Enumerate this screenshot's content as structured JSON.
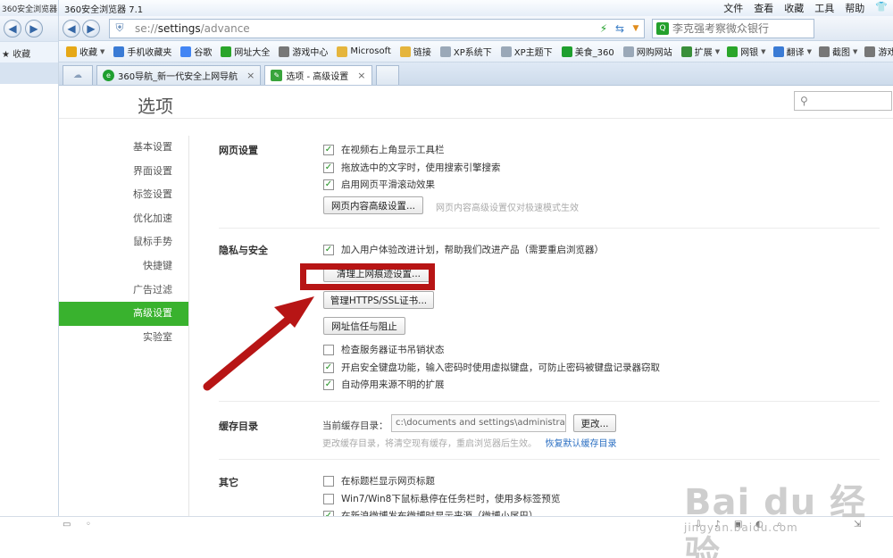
{
  "ghost": {
    "title": "360安全浏览器",
    "fav": "收藏"
  },
  "window": {
    "title": "360安全浏览器 7.1",
    "menus": [
      "文件",
      "查看",
      "收藏",
      "工具",
      "帮助"
    ]
  },
  "address": {
    "scheme": "se://",
    "path": "settings",
    "rest": "/advance"
  },
  "search_bar": {
    "placeholder": "李克强考察微众银行"
  },
  "favorites": [
    {
      "label": "收藏",
      "icon": "star-icon",
      "color": "#e6a817",
      "caret": true
    },
    {
      "label": "手机收藏夹",
      "icon": "phone-icon",
      "color": "#3a7bd5",
      "caret": false
    },
    {
      "label": "谷歌",
      "icon": "google-icon",
      "color": "#4285f4",
      "caret": false
    },
    {
      "label": "网址大全",
      "icon": "globe-icon",
      "color": "#2aa52a",
      "caret": false
    },
    {
      "label": "游戏中心",
      "icon": "gamepad-icon",
      "color": "#777777",
      "caret": false
    },
    {
      "label": "Microsoft",
      "icon": "folder-icon",
      "color": "#e5b53d",
      "caret": false
    },
    {
      "label": "链接",
      "icon": "folder-icon",
      "color": "#e5b53d",
      "caret": false
    },
    {
      "label": "XP系统下",
      "icon": "page-icon",
      "color": "#9aa8b8",
      "caret": false
    },
    {
      "label": "XP主题下",
      "icon": "page-icon",
      "color": "#9aa8b8",
      "caret": false
    },
    {
      "label": "美食_360",
      "icon": "e-icon",
      "color": "#1f9f2f",
      "caret": false
    },
    {
      "label": "网购网站",
      "icon": "page-icon",
      "color": "#9aa8b8",
      "caret": false
    }
  ],
  "toolbar_right": [
    {
      "label": "扩展",
      "icon": "puzzle-icon",
      "color": "#3a8f3a"
    },
    {
      "label": "网银",
      "icon": "shield-icon",
      "color": "#2aa52a"
    },
    {
      "label": "翻译",
      "icon": "translate-icon",
      "color": "#3a7bd5"
    },
    {
      "label": "截图",
      "icon": "scissors-icon",
      "color": "#777777"
    },
    {
      "label": "游戏",
      "icon": "game-icon",
      "color": "#777777"
    }
  ],
  "tabs": [
    {
      "label": "360导航_新一代安全上网导航",
      "active": false
    },
    {
      "label": "选项 - 高级设置",
      "active": true
    }
  ],
  "page": {
    "title": "选项",
    "sidebar": [
      "基本设置",
      "界面设置",
      "标签设置",
      "优化加速",
      "鼠标手势",
      "快捷键",
      "广告过滤",
      "高级设置",
      "实验室"
    ],
    "active_index": 7,
    "sections": {
      "web": {
        "label": "网页设置",
        "options": [
          {
            "text": "在视频右上角显示工具栏",
            "checked": true
          },
          {
            "text": "拖放选中的文字时，使用搜索引擎搜索",
            "checked": true
          },
          {
            "text": "启用网页平滑滚动效果",
            "checked": true
          }
        ],
        "button": "网页内容高级设置...",
        "hint": "网页内容高级设置仅对极速模式生效"
      },
      "privacy": {
        "label": "隐私与安全",
        "join": {
          "text": "加入用户体验改进计划，帮助我们改进产品（需要重启浏览器）",
          "checked": true
        },
        "buttons": [
          "清理上网痕迹设置...",
          "管理HTTPS/SSL证书...",
          "网址信任与阻止"
        ],
        "options": [
          {
            "text": "检查服务器证书吊销状态",
            "checked": false
          },
          {
            "text": "开启安全键盘功能，输入密码时使用虚拟键盘，可防止密码被键盘记录器窃取",
            "checked": true
          },
          {
            "text": "自动停用来源不明的扩展",
            "checked": true
          }
        ]
      },
      "cache": {
        "label": "缓存目录",
        "current_label": "当前缓存目录：",
        "path": "c:\\documents and settings\\administrator\\a",
        "change_button": "更改...",
        "hint": "更改缓存目录，将清空现有缓存，重启浏览器后生效。",
        "restore_link": "恢复默认缓存目录"
      },
      "other": {
        "label": "其它",
        "options": [
          {
            "text": "在标题栏显示网页标题",
            "checked": false
          },
          {
            "text": "Win7/Win8下鼠标悬停在任务栏时，使用多标签预览",
            "checked": false
          },
          {
            "text": "在新浪微博发布微博时显示来源（微博小尾巴）",
            "checked": true
          }
        ]
      }
    }
  },
  "watermark": {
    "big": "Bai du 经验",
    "small": "jingyan.baidu.com"
  },
  "colors": {
    "accent_green": "#39b22e",
    "annotation_red": "#b71515",
    "link_blue": "#2b6fc2"
  }
}
